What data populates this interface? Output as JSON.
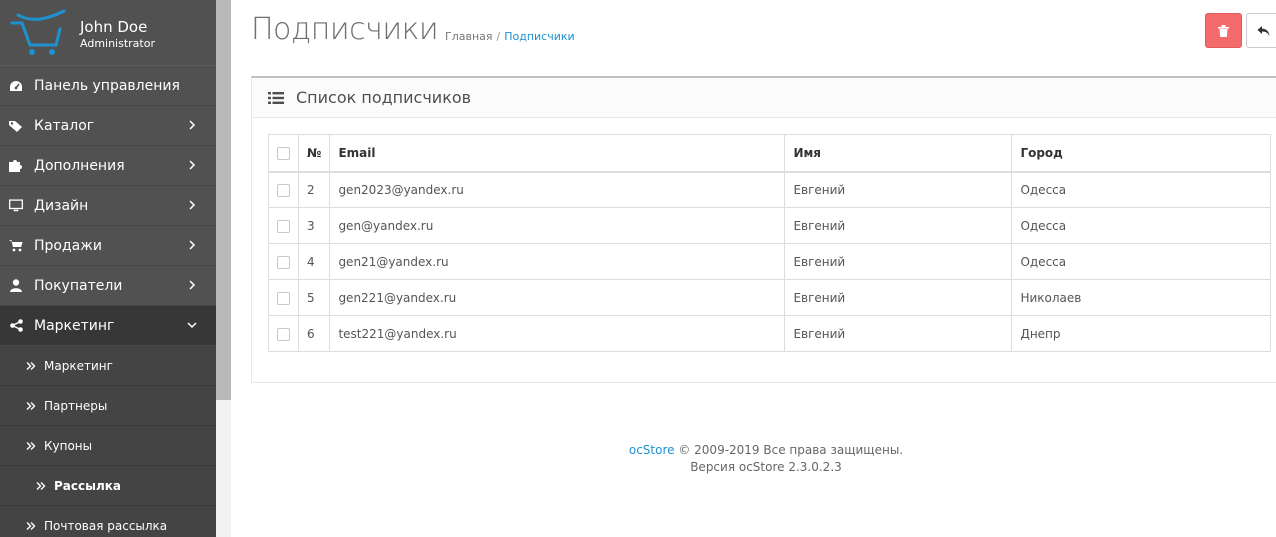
{
  "user": {
    "name": "John Doe",
    "role": "Administrator"
  },
  "sidebar": {
    "items": [
      {
        "label": "Панель управления",
        "icon": "dashboard-icon",
        "has_chevron": false
      },
      {
        "label": "Каталог",
        "icon": "tags-icon",
        "has_chevron": true
      },
      {
        "label": "Дополнения",
        "icon": "puzzle-icon",
        "has_chevron": true
      },
      {
        "label": "Дизайн",
        "icon": "monitor-icon",
        "has_chevron": true
      },
      {
        "label": "Продажи",
        "icon": "cart-icon",
        "has_chevron": true
      },
      {
        "label": "Покупатели",
        "icon": "user-icon",
        "has_chevron": true
      },
      {
        "label": "Маркетинг",
        "icon": "share-icon",
        "has_chevron": true,
        "expanded": true
      }
    ],
    "sub_items": [
      {
        "label": "Маркетинг"
      },
      {
        "label": "Партнеры"
      },
      {
        "label": "Купоны"
      },
      {
        "label": "Рассылка",
        "current": true
      },
      {
        "label": "Почтовая рассылка"
      }
    ]
  },
  "header": {
    "title": "Подписчики",
    "breadcrumb": [
      "Главная",
      "Подписчики"
    ]
  },
  "panel": {
    "title": "Список подписчиков",
    "columns": [
      "№",
      "Email",
      "Имя",
      "Город"
    ],
    "rows": [
      {
        "id": "2",
        "email": "gen2023@yandex.ru",
        "name": "Евгений",
        "city": "Одесса"
      },
      {
        "id": "3",
        "email": "gen@yandex.ru",
        "name": "Евгений",
        "city": "Одесса"
      },
      {
        "id": "4",
        "email": "gen21@yandex.ru",
        "name": "Евгений",
        "city": "Одесса"
      },
      {
        "id": "5",
        "email": "gen221@yandex.ru",
        "name": "Евгений",
        "city": "Николаев"
      },
      {
        "id": "6",
        "email": "test221@yandex.ru",
        "name": "Евгений",
        "city": "Днепр"
      }
    ]
  },
  "footer": {
    "brand": "ocStore",
    "copyright": "© 2009-2019 Все права защищены.",
    "version": "Версия ocStore 2.3.0.2.3"
  },
  "colors": {
    "accent": "#1e91cf",
    "danger": "#f56b6b",
    "sidebar": "#515151"
  }
}
